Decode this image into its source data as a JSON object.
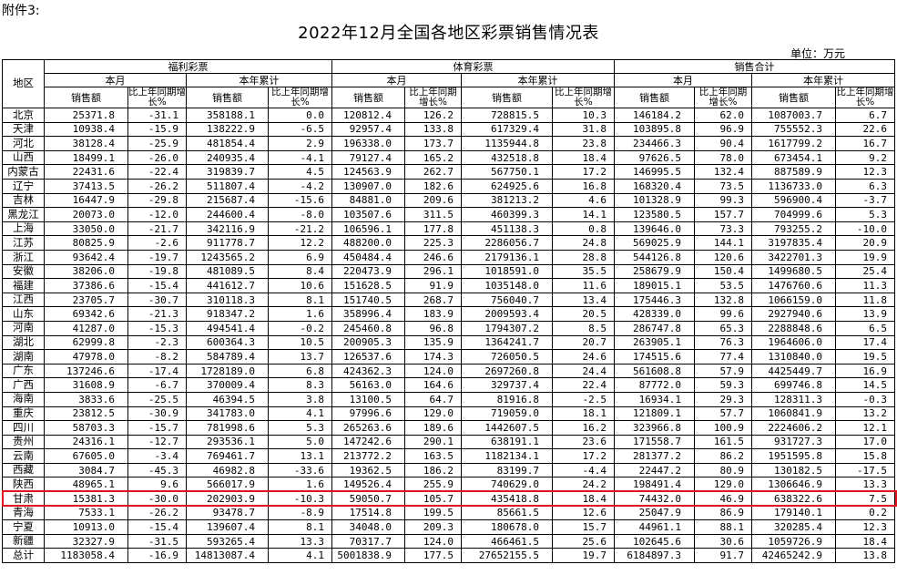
{
  "attachment_label": "附件3:",
  "title": "2022年12月全国各地区彩票销售情况表",
  "unit": "单位：万元",
  "headers": {
    "region": "地区",
    "welfare": "福利彩票",
    "sports": "体育彩票",
    "total": "销售合计",
    "this_month": "本月",
    "year_to_date": "本年累计",
    "sales": "销售额",
    "yoy": "比上年同期增长%"
  },
  "rows": [
    {
      "region": "北京",
      "w_m": "25371.8",
      "w_m_p": "-31.1",
      "w_y": "358188.1",
      "w_y_p": "0.0",
      "s_m": "120812.4",
      "s_m_p": "126.2",
      "s_y": "728815.5",
      "s_y_p": "10.3",
      "t_m": "146184.2",
      "t_m_p": "62.0",
      "t_y": "1087003.7",
      "t_y_p": "6.7"
    },
    {
      "region": "天津",
      "w_m": "10938.4",
      "w_m_p": "-15.9",
      "w_y": "138222.9",
      "w_y_p": "-6.5",
      "s_m": "92957.4",
      "s_m_p": "133.8",
      "s_y": "617329.4",
      "s_y_p": "31.8",
      "t_m": "103895.8",
      "t_m_p": "96.9",
      "t_y": "755552.3",
      "t_y_p": "22.6"
    },
    {
      "region": "河北",
      "w_m": "38128.4",
      "w_m_p": "-25.9",
      "w_y": "481854.4",
      "w_y_p": "2.9",
      "s_m": "196338.0",
      "s_m_p": "173.7",
      "s_y": "1135944.8",
      "s_y_p": "23.8",
      "t_m": "234466.3",
      "t_m_p": "90.4",
      "t_y": "1617799.2",
      "t_y_p": "16.7"
    },
    {
      "region": "山西",
      "w_m": "18499.1",
      "w_m_p": "-26.0",
      "w_y": "240935.4",
      "w_y_p": "-4.1",
      "s_m": "79127.4",
      "s_m_p": "165.2",
      "s_y": "432518.8",
      "s_y_p": "18.4",
      "t_m": "97626.5",
      "t_m_p": "78.0",
      "t_y": "673454.1",
      "t_y_p": "9.2"
    },
    {
      "region": "内蒙古",
      "w_m": "22431.6",
      "w_m_p": "-22.4",
      "w_y": "319839.7",
      "w_y_p": "4.5",
      "s_m": "124563.9",
      "s_m_p": "262.7",
      "s_y": "567750.1",
      "s_y_p": "17.2",
      "t_m": "146995.5",
      "t_m_p": "132.4",
      "t_y": "887589.9",
      "t_y_p": "12.3"
    },
    {
      "region": "辽宁",
      "w_m": "37413.5",
      "w_m_p": "-26.2",
      "w_y": "511807.4",
      "w_y_p": "-4.2",
      "s_m": "130907.0",
      "s_m_p": "182.6",
      "s_y": "624925.6",
      "s_y_p": "16.8",
      "t_m": "168320.4",
      "t_m_p": "73.5",
      "t_y": "1136733.0",
      "t_y_p": "6.3"
    },
    {
      "region": "吉林",
      "w_m": "16447.9",
      "w_m_p": "-29.8",
      "w_y": "215687.4",
      "w_y_p": "-15.6",
      "s_m": "84881.0",
      "s_m_p": "209.6",
      "s_y": "381213.2",
      "s_y_p": "4.6",
      "t_m": "101328.9",
      "t_m_p": "99.3",
      "t_y": "596900.4",
      "t_y_p": "-3.7"
    },
    {
      "region": "黑龙江",
      "w_m": "20073.0",
      "w_m_p": "-12.0",
      "w_y": "244600.4",
      "w_y_p": "-8.0",
      "s_m": "103507.6",
      "s_m_p": "311.5",
      "s_y": "460399.3",
      "s_y_p": "14.1",
      "t_m": "123580.5",
      "t_m_p": "157.7",
      "t_y": "704999.6",
      "t_y_p": "5.3"
    },
    {
      "region": "上海",
      "w_m": "33050.0",
      "w_m_p": "-21.7",
      "w_y": "342116.9",
      "w_y_p": "-21.2",
      "s_m": "106596.1",
      "s_m_p": "177.8",
      "s_y": "451138.3",
      "s_y_p": "0.8",
      "t_m": "139646.0",
      "t_m_p": "73.3",
      "t_y": "793255.2",
      "t_y_p": "-10.0"
    },
    {
      "region": "江苏",
      "w_m": "80825.9",
      "w_m_p": "-2.6",
      "w_y": "911778.7",
      "w_y_p": "12.2",
      "s_m": "488200.0",
      "s_m_p": "225.3",
      "s_y": "2286056.7",
      "s_y_p": "24.8",
      "t_m": "569025.9",
      "t_m_p": "144.1",
      "t_y": "3197835.4",
      "t_y_p": "20.9"
    },
    {
      "region": "浙江",
      "w_m": "93642.4",
      "w_m_p": "-19.7",
      "w_y": "1243565.2",
      "w_y_p": "6.9",
      "s_m": "450484.4",
      "s_m_p": "246.6",
      "s_y": "2179136.1",
      "s_y_p": "28.8",
      "t_m": "544126.8",
      "t_m_p": "120.6",
      "t_y": "3422701.3",
      "t_y_p": "19.9"
    },
    {
      "region": "安徽",
      "w_m": "38206.0",
      "w_m_p": "-19.8",
      "w_y": "481089.5",
      "w_y_p": "8.4",
      "s_m": "220473.9",
      "s_m_p": "296.1",
      "s_y": "1018591.0",
      "s_y_p": "35.5",
      "t_m": "258679.9",
      "t_m_p": "150.4",
      "t_y": "1499680.5",
      "t_y_p": "25.4"
    },
    {
      "region": "福建",
      "w_m": "37386.6",
      "w_m_p": "-15.4",
      "w_y": "441612.7",
      "w_y_p": "10.6",
      "s_m": "151628.5",
      "s_m_p": "91.9",
      "s_y": "1035148.0",
      "s_y_p": "11.6",
      "t_m": "189015.1",
      "t_m_p": "53.5",
      "t_y": "1476760.6",
      "t_y_p": "11.3"
    },
    {
      "region": "江西",
      "w_m": "23705.7",
      "w_m_p": "-30.7",
      "w_y": "310118.3",
      "w_y_p": "8.1",
      "s_m": "151740.5",
      "s_m_p": "268.7",
      "s_y": "756040.7",
      "s_y_p": "13.4",
      "t_m": "175446.3",
      "t_m_p": "132.8",
      "t_y": "1066159.0",
      "t_y_p": "11.8"
    },
    {
      "region": "山东",
      "w_m": "69342.6",
      "w_m_p": "-21.3",
      "w_y": "918347.2",
      "w_y_p": "1.6",
      "s_m": "358996.4",
      "s_m_p": "183.9",
      "s_y": "2009593.4",
      "s_y_p": "20.5",
      "t_m": "428339.0",
      "t_m_p": "99.6",
      "t_y": "2927940.6",
      "t_y_p": "13.9"
    },
    {
      "region": "河南",
      "w_m": "41287.0",
      "w_m_p": "-15.3",
      "w_y": "494541.4",
      "w_y_p": "-0.2",
      "s_m": "245460.8",
      "s_m_p": "96.8",
      "s_y": "1794307.2",
      "s_y_p": "8.5",
      "t_m": "286747.8",
      "t_m_p": "65.3",
      "t_y": "2288848.6",
      "t_y_p": "6.5"
    },
    {
      "region": "湖北",
      "w_m": "62999.8",
      "w_m_p": "-2.3",
      "w_y": "600364.3",
      "w_y_p": "10.5",
      "s_m": "200905.3",
      "s_m_p": "135.9",
      "s_y": "1364241.7",
      "s_y_p": "20.7",
      "t_m": "263905.1",
      "t_m_p": "76.3",
      "t_y": "1964606.0",
      "t_y_p": "17.4"
    },
    {
      "region": "湖南",
      "w_m": "47978.0",
      "w_m_p": "-8.2",
      "w_y": "584789.4",
      "w_y_p": "13.7",
      "s_m": "126537.6",
      "s_m_p": "174.3",
      "s_y": "726050.5",
      "s_y_p": "24.6",
      "t_m": "174515.6",
      "t_m_p": "77.4",
      "t_y": "1310840.0",
      "t_y_p": "19.5"
    },
    {
      "region": "广东",
      "w_m": "137246.6",
      "w_m_p": "-17.4",
      "w_y": "1728189.0",
      "w_y_p": "6.8",
      "s_m": "424362.3",
      "s_m_p": "124.0",
      "s_y": "2697260.8",
      "s_y_p": "24.4",
      "t_m": "561608.8",
      "t_m_p": "57.9",
      "t_y": "4425449.7",
      "t_y_p": "16.9"
    },
    {
      "region": "广西",
      "w_m": "31608.9",
      "w_m_p": "-6.7",
      "w_y": "370009.4",
      "w_y_p": "8.3",
      "s_m": "56163.0",
      "s_m_p": "164.6",
      "s_y": "329737.4",
      "s_y_p": "22.4",
      "t_m": "87772.0",
      "t_m_p": "59.3",
      "t_y": "699746.8",
      "t_y_p": "14.5"
    },
    {
      "region": "海南",
      "w_m": "3833.6",
      "w_m_p": "-25.5",
      "w_y": "46394.5",
      "w_y_p": "3.8",
      "s_m": "13100.5",
      "s_m_p": "64.7",
      "s_y": "81916.8",
      "s_y_p": "-2.5",
      "t_m": "16934.1",
      "t_m_p": "29.3",
      "t_y": "128311.3",
      "t_y_p": "-0.3"
    },
    {
      "region": "重庆",
      "w_m": "23812.5",
      "w_m_p": "-30.9",
      "w_y": "341783.0",
      "w_y_p": "4.1",
      "s_m": "97996.6",
      "s_m_p": "129.0",
      "s_y": "719059.0",
      "s_y_p": "18.1",
      "t_m": "121809.1",
      "t_m_p": "57.7",
      "t_y": "1060841.9",
      "t_y_p": "13.2"
    },
    {
      "region": "四川",
      "w_m": "58703.3",
      "w_m_p": "-15.7",
      "w_y": "781998.6",
      "w_y_p": "5.3",
      "s_m": "265263.6",
      "s_m_p": "189.6",
      "s_y": "1442607.5",
      "s_y_p": "16.2",
      "t_m": "323966.8",
      "t_m_p": "100.9",
      "t_y": "2224606.2",
      "t_y_p": "12.1"
    },
    {
      "region": "贵州",
      "w_m": "24316.1",
      "w_m_p": "-12.7",
      "w_y": "293536.1",
      "w_y_p": "5.0",
      "s_m": "147242.6",
      "s_m_p": "290.1",
      "s_y": "638191.1",
      "s_y_p": "23.6",
      "t_m": "171558.7",
      "t_m_p": "161.5",
      "t_y": "931727.3",
      "t_y_p": "17.0"
    },
    {
      "region": "云南",
      "w_m": "67605.0",
      "w_m_p": "-3.4",
      "w_y": "769461.7",
      "w_y_p": "13.1",
      "s_m": "213772.2",
      "s_m_p": "163.5",
      "s_y": "1182134.1",
      "s_y_p": "17.2",
      "t_m": "281377.2",
      "t_m_p": "86.2",
      "t_y": "1951595.8",
      "t_y_p": "15.8"
    },
    {
      "region": "西藏",
      "w_m": "3084.7",
      "w_m_p": "-45.3",
      "w_y": "46982.8",
      "w_y_p": "-33.6",
      "s_m": "19362.5",
      "s_m_p": "186.2",
      "s_y": "83199.7",
      "s_y_p": "-4.4",
      "t_m": "22447.2",
      "t_m_p": "80.9",
      "t_y": "130182.5",
      "t_y_p": "-17.5"
    },
    {
      "region": "陕西",
      "w_m": "48965.1",
      "w_m_p": "9.6",
      "w_y": "566017.9",
      "w_y_p": "1.6",
      "s_m": "149526.4",
      "s_m_p": "255.9",
      "s_y": "740629.0",
      "s_y_p": "24.2",
      "t_m": "198491.4",
      "t_m_p": "129.0",
      "t_y": "1306646.9",
      "t_y_p": "13.3"
    },
    {
      "region": "甘肃",
      "w_m": "15381.3",
      "w_m_p": "-30.0",
      "w_y": "202903.9",
      "w_y_p": "-10.3",
      "s_m": "59050.7",
      "s_m_p": "105.7",
      "s_y": "435418.8",
      "s_y_p": "18.4",
      "t_m": "74432.0",
      "t_m_p": "46.9",
      "t_y": "638322.6",
      "t_y_p": "7.5"
    },
    {
      "region": "青海",
      "w_m": "7533.1",
      "w_m_p": "-26.2",
      "w_y": "93478.7",
      "w_y_p": "-8.9",
      "s_m": "17514.8",
      "s_m_p": "199.5",
      "s_y": "85661.5",
      "s_y_p": "12.6",
      "t_m": "25047.9",
      "t_m_p": "86.9",
      "t_y": "179140.1",
      "t_y_p": "0.2"
    },
    {
      "region": "宁夏",
      "w_m": "10913.0",
      "w_m_p": "-15.4",
      "w_y": "139607.4",
      "w_y_p": "8.1",
      "s_m": "34048.0",
      "s_m_p": "209.3",
      "s_y": "180678.0",
      "s_y_p": "15.7",
      "t_m": "44961.1",
      "t_m_p": "88.1",
      "t_y": "320285.4",
      "t_y_p": "12.3"
    },
    {
      "region": "新疆",
      "w_m": "32327.9",
      "w_m_p": "-31.5",
      "w_y": "593265.4",
      "w_y_p": "13.3",
      "s_m": "70317.7",
      "s_m_p": "124.0",
      "s_y": "466461.5",
      "s_y_p": "25.6",
      "t_m": "102645.6",
      "t_m_p": "30.6",
      "t_y": "1059726.9",
      "t_y_p": "18.4"
    },
    {
      "region": "总计",
      "w_m": "1183058.4",
      "w_m_p": "-16.9",
      "w_y": "14813087.4",
      "w_y_p": "4.1",
      "s_m": "5001838.9",
      "s_m_p": "177.5",
      "s_y": "27652155.5",
      "s_y_p": "19.7",
      "t_m": "6184897.3",
      "t_m_p": "91.7",
      "t_y": "42465242.9",
      "t_y_p": "13.8"
    }
  ],
  "highlighted_region": "甘肃",
  "colors": {
    "highlight_border": "#e0141e",
    "grid": "#000000",
    "background": "#ffffff"
  }
}
